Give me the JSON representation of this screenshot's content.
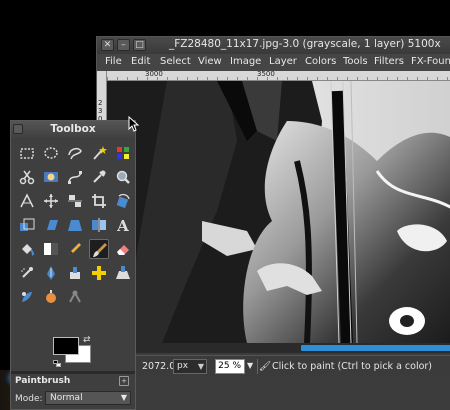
{
  "window": {
    "title": "_FZ28480_11x17.jpg-3.0 (grayscale, 1 layer) 5100x",
    "controls": {
      "close": "✕",
      "minimize": "–",
      "maximize": "□"
    },
    "menu": [
      "File",
      "Edit",
      "Select",
      "View",
      "Image",
      "Layer",
      "Colors",
      "Tools",
      "Filters",
      "FX-Found"
    ],
    "ruler_labels": [
      "3000",
      "3500"
    ],
    "ruler_v_labels": [
      "2",
      "3",
      "0",
      "0"
    ],
    "statusbar": {
      "coords": "2072.0",
      "unit": "px",
      "zoom": "25 %",
      "message": "Click to paint (Ctrl to pick a color)"
    }
  },
  "toolbox": {
    "title": "Toolbox",
    "active_tool": "paintbrush",
    "tools": [
      "rect-select",
      "ellipse-select",
      "free-select",
      "fuzzy-select",
      "select-by-color",
      "scissors-select",
      "foreground-select",
      "paths",
      "color-picker",
      "zoom",
      "measure",
      "move",
      "align",
      "crop",
      "rotate",
      "scale",
      "shear",
      "perspective",
      "flip",
      "text",
      "bucket-fill",
      "blend",
      "pencil",
      "paintbrush",
      "eraser",
      "airbrush",
      "ink",
      "clone",
      "heal",
      "perspective-clone",
      "smudge",
      "dodge-burn",
      "convolve"
    ],
    "tool_options": {
      "title": "Paintbrush",
      "mode_label": "Mode:",
      "mode_value": "Normal"
    }
  },
  "colors": {
    "foreground": "#000000",
    "background": "#ffffff",
    "accent": "#2e8fd9"
  }
}
